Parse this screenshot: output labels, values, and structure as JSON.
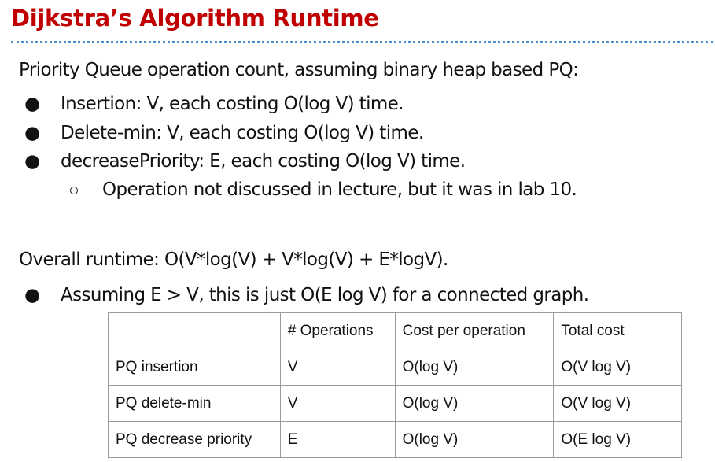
{
  "slide": {
    "title": "Dijkstra’s Algorithm Runtime",
    "title_color": "#c00000",
    "rule_color": "#4f8fc9"
  },
  "body": {
    "intro": "Priority Queue operation count, assuming binary heap based PQ:",
    "bullets": [
      "Insertion: V, each costing O(log V) time.",
      "Delete-min: V, each costing O(log V) time.",
      "decreasePriority: E, each costing O(log V) time."
    ],
    "sub_bullet": "Operation not discussed in lecture, but it was in lab 10.",
    "overall": "Overall runtime: O(V*log(V) + V*log(V) + E*logV).",
    "overall_bullet": "Assuming E > V, this is just O(E log V) for a connected graph."
  },
  "table": {
    "headers": [
      "",
      "# Operations",
      "Cost per operation",
      "Total cost"
    ],
    "rows": [
      [
        "PQ insertion",
        "V",
        "O(log V)",
        "O(V log V)"
      ],
      [
        "PQ delete-min",
        "V",
        "O(log V)",
        "O(V log V)"
      ],
      [
        "PQ decrease priority",
        "E",
        "O(log V)",
        "O(E log V)"
      ]
    ]
  }
}
